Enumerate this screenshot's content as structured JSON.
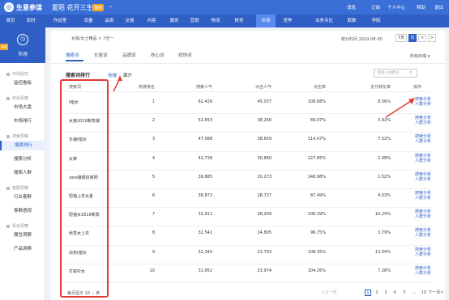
{
  "brand": {
    "name": "生意参谋",
    "shop": "夏陌 花开三生",
    "badge": "旗舰"
  },
  "topright": {
    "message": "消息",
    "subscribe": "订阅",
    "personal": "个人中心",
    "help": "帮助",
    "logout": "退出"
  },
  "nav": [
    "首页",
    "实时",
    "作战室",
    "流量",
    "品类",
    "交易",
    "内容",
    "服务",
    "营销",
    "物流",
    "财务",
    "市场",
    "竞争",
    "业务专区",
    "取数",
    "学院"
  ],
  "nav_active": 11,
  "sidebar": {
    "market_label": "市场",
    "flag": "旗舰",
    "groups": [
      {
        "label": "市场监控",
        "items": [
          "监控看板"
        ]
      },
      {
        "label": "供给洞察",
        "items": [
          "市场大盘",
          "市场排行"
        ]
      },
      {
        "label": "搜索洞察",
        "items": [
          "搜索排行",
          "搜索分析",
          "搜索人群"
        ]
      },
      {
        "label": "客群洞察",
        "items": [
          "行业客群",
          "客群透视"
        ]
      },
      {
        "label": "机会洞察",
        "items": [
          "属性洞察",
          "产品洞察"
        ]
      }
    ],
    "active_item": "搜索排行"
  },
  "header": {
    "breadcrumb": "女装/女士精品 > 7也一",
    "stat_time": "统计时间 2019-08-30",
    "periods": [
      "7天",
      "日",
      "<",
      ">"
    ],
    "terminal": "所有终端 ▾"
  },
  "tabs": [
    "搜索词",
    "长尾词",
    "品牌词",
    "核心词",
    "修饰词"
  ],
  "active_tab": 0,
  "rank": {
    "title": "搜索词排行",
    "subtabs": [
      "热搜",
      "飙升"
    ],
    "search_placeholder": "请输入关键词"
  },
  "columns": [
    "搜索词",
    "热搜排名",
    "搜索人气",
    "点击人气",
    "点击率",
    "支付转化率",
    "操作"
  ],
  "rows": [
    {
      "term": "t恤女",
      "rank": "1",
      "search": "62,426",
      "click": "45,037",
      "ctr": "108.68%",
      "conv": "8.56%"
    },
    {
      "term": "女装2019新款潮",
      "rank": "2",
      "search": "52,653",
      "click": "38,256",
      "ctr": "89.07%",
      "conv": "3.92%"
    },
    {
      "term": "长袖t恤女",
      "rank": "3",
      "search": "47,088",
      "click": "38,659",
      "ctr": "114.07%",
      "conv": "7.52%"
    },
    {
      "term": "女裤",
      "rank": "4",
      "search": "42,738",
      "click": "30,860",
      "ctr": "127.85%",
      "conv": "2.48%"
    },
    {
      "term": "zara旗舰店官网",
      "rank": "5",
      "search": "39,885",
      "click": "20,273",
      "ctr": "148.98%",
      "conv": "1.52%"
    },
    {
      "term": "短袖上衣女夏",
      "rank": "6",
      "search": "38,872",
      "click": "28,727",
      "ctr": "87.49%",
      "conv": "4.03%"
    },
    {
      "term": "短袖女2019新款",
      "rank": "7",
      "search": "32,911",
      "click": "26,209",
      "ctr": "106.39%",
      "conv": "10.24%"
    },
    {
      "term": "秋季女上衣",
      "rank": "8",
      "search": "32,541",
      "click": "24,805",
      "ctr": "96.75%",
      "conv": "3.79%"
    },
    {
      "term": "白色t恤女",
      "rank": "9",
      "search": "32,340",
      "click": "23,703",
      "ctr": "108.35%",
      "conv": "13.04%"
    },
    {
      "term": "打底衫女",
      "rank": "10",
      "search": "31,952",
      "click": "23,974",
      "ctr": "104.26%",
      "conv": "7.26%"
    }
  ],
  "ops": [
    "搜索分析",
    "人群分析"
  ],
  "pager": {
    "per_page_label": "每页显示",
    "per_page": "10",
    "unit": "条",
    "prev": "<上一页",
    "pages": [
      "1",
      "2",
      "3",
      "4",
      "5",
      "...",
      "10"
    ],
    "next": "下一页>"
  },
  "colors": {
    "primary": "#2f5fc4",
    "highlight": "#e53935"
  }
}
